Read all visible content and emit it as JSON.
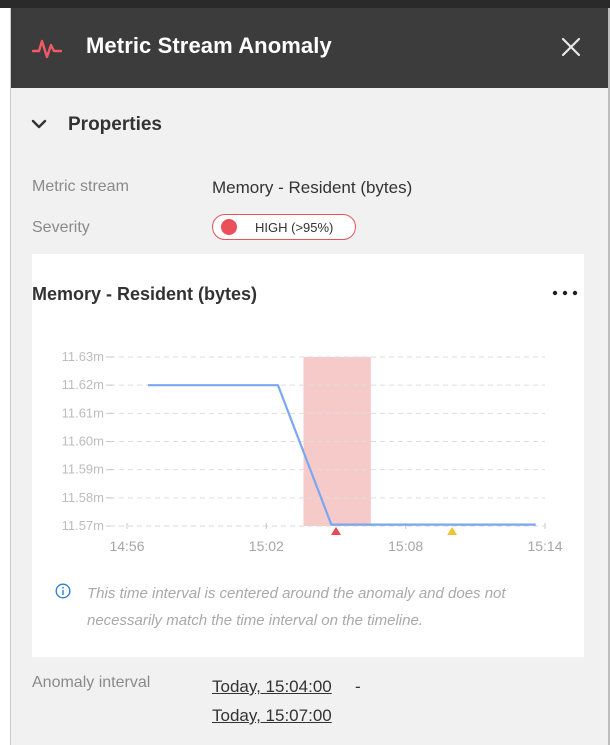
{
  "header": {
    "title": "Metric Stream Anomaly",
    "logo_icon": "pulse-icon",
    "close_icon": "close-icon"
  },
  "properties": {
    "section_label": "Properties",
    "metric_stream_label": "Metric stream",
    "metric_stream_value": "Memory - Resident (bytes)",
    "severity_label": "Severity",
    "severity_value": "HIGH (>95%)",
    "severity_color": "#ea4f5a"
  },
  "chart_card": {
    "title": "Memory - Resident (bytes)",
    "menu_icon": "more-icon",
    "info_icon": "info-icon",
    "note": "This time interval is centered around the anomaly and does not necessarily match the time interval on the timeline."
  },
  "chart_data": {
    "type": "line",
    "title": "Memory - Resident (bytes)",
    "xlabel": "",
    "ylabel": "",
    "y_ticks": [
      "11.63m",
      "11.62m",
      "11.61m",
      "11.60m",
      "11.59m",
      "11.58m",
      "11.57m"
    ],
    "y_tick_values": [
      11.63,
      11.62,
      11.61,
      11.6,
      11.59,
      11.58,
      11.57
    ],
    "ylim": [
      11.57,
      11.63
    ],
    "x_ticks": [
      "14:56",
      "15:02",
      "15:08",
      "15:14"
    ],
    "x_tick_minutes": [
      0,
      6,
      12,
      18
    ],
    "xlim_minutes": [
      0,
      18
    ],
    "grid": true,
    "series": [
      {
        "color": "#7aa7f2",
        "x_minutes": [
          0.9,
          6.5,
          8.8,
          17.6
        ],
        "values": [
          11.62,
          11.62,
          11.5705,
          11.5705
        ]
      }
    ],
    "highlight": {
      "x_start_minutes": 7.6,
      "x_end_minutes": 10.5,
      "color": "#f7caca"
    },
    "markers": [
      {
        "x_minutes": 9.0,
        "color": "#e5484d",
        "kind": "triangle-up"
      },
      {
        "x_minutes": 14.0,
        "color": "#f3c233",
        "kind": "triangle-up"
      }
    ]
  },
  "anomaly_interval": {
    "label": "Anomaly interval",
    "start": "Today, 15:04:00",
    "separator": "-",
    "end": "Today, 15:07:00"
  }
}
